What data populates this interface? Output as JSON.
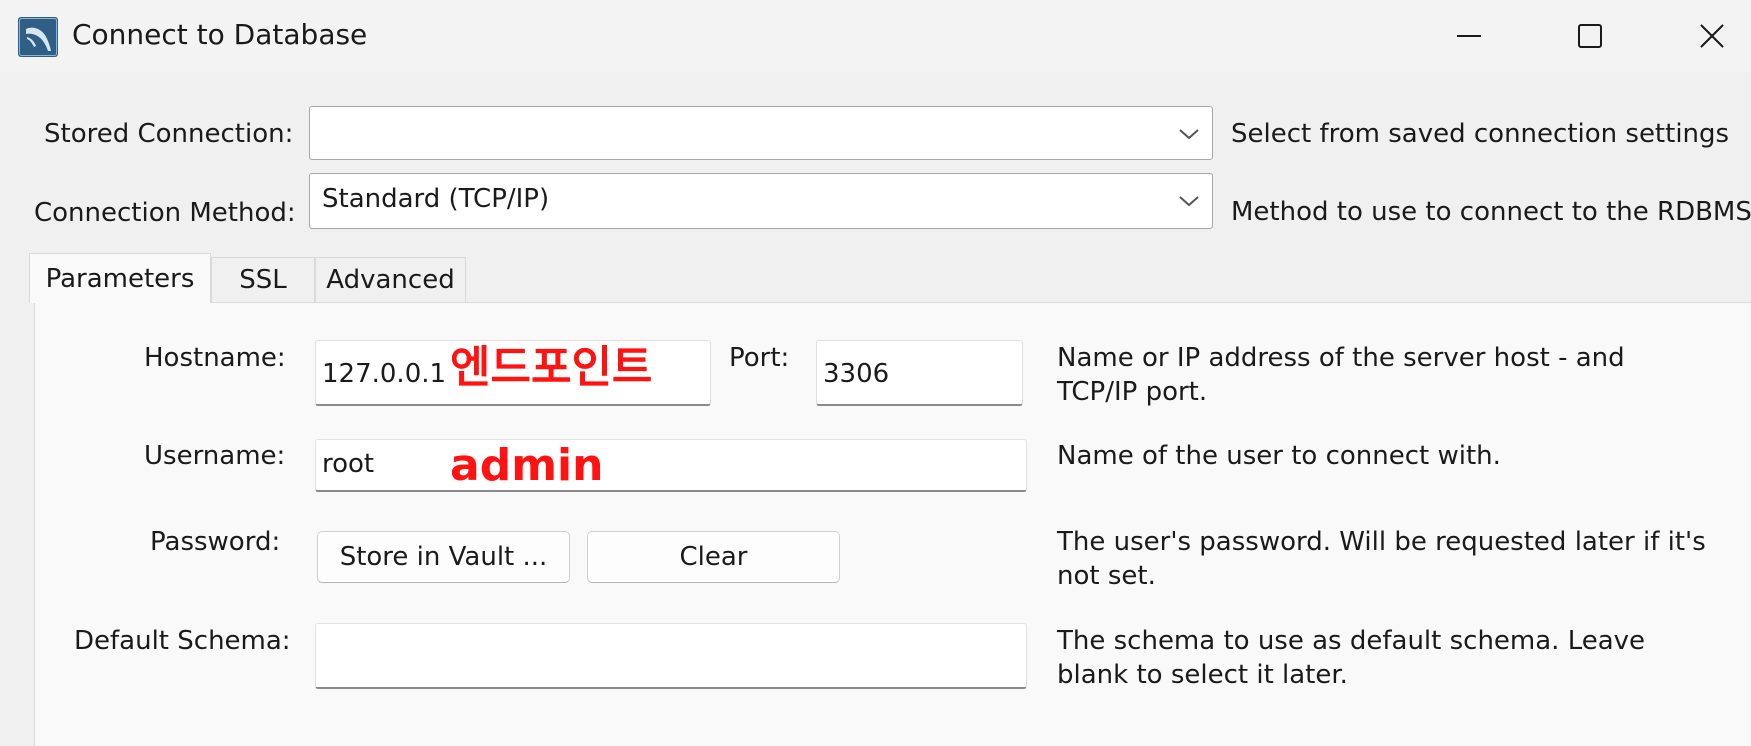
{
  "window": {
    "title": "Connect to Database",
    "icons": {
      "app": "mysql-workbench-dolphin-icon",
      "minimize": "minimize-icon",
      "maximize": "maximize-icon",
      "close": "close-icon"
    }
  },
  "stored_connection": {
    "label": "Stored Connection:",
    "value": "",
    "description": "Select from saved connection settings"
  },
  "connection_method": {
    "label": "Connection Method:",
    "value": "Standard (TCP/IP)",
    "description": "Method to use to connect to the RDBMS"
  },
  "tabs": [
    {
      "label": "Parameters",
      "active": true
    },
    {
      "label": "SSL",
      "active": false
    },
    {
      "label": "Advanced",
      "active": false
    }
  ],
  "parameters": {
    "hostname": {
      "label": "Hostname:",
      "value": "127.0.0.1",
      "annotation": "엔드포인트",
      "description_line1": "Name or IP address of the server host - and",
      "description_line2": "TCP/IP port."
    },
    "port": {
      "label": "Port:",
      "value": "3306"
    },
    "username": {
      "label": "Username:",
      "value": "root",
      "annotation": "admin",
      "description": "Name of the user to connect with."
    },
    "password": {
      "label": "Password:",
      "store_button": "Store in Vault ...",
      "clear_button": "Clear",
      "description_line1": "The user's password. Will be requested later if it's",
      "description_line2": "not set."
    },
    "default_schema": {
      "label": "Default Schema:",
      "value": "",
      "description_line1": "The schema to use as default schema. Leave",
      "description_line2": "blank to select it later."
    }
  },
  "colors": {
    "annotation": "#ff1212",
    "window_bg": "#f0f0f0",
    "panel_bg": "#f9f9f9"
  }
}
